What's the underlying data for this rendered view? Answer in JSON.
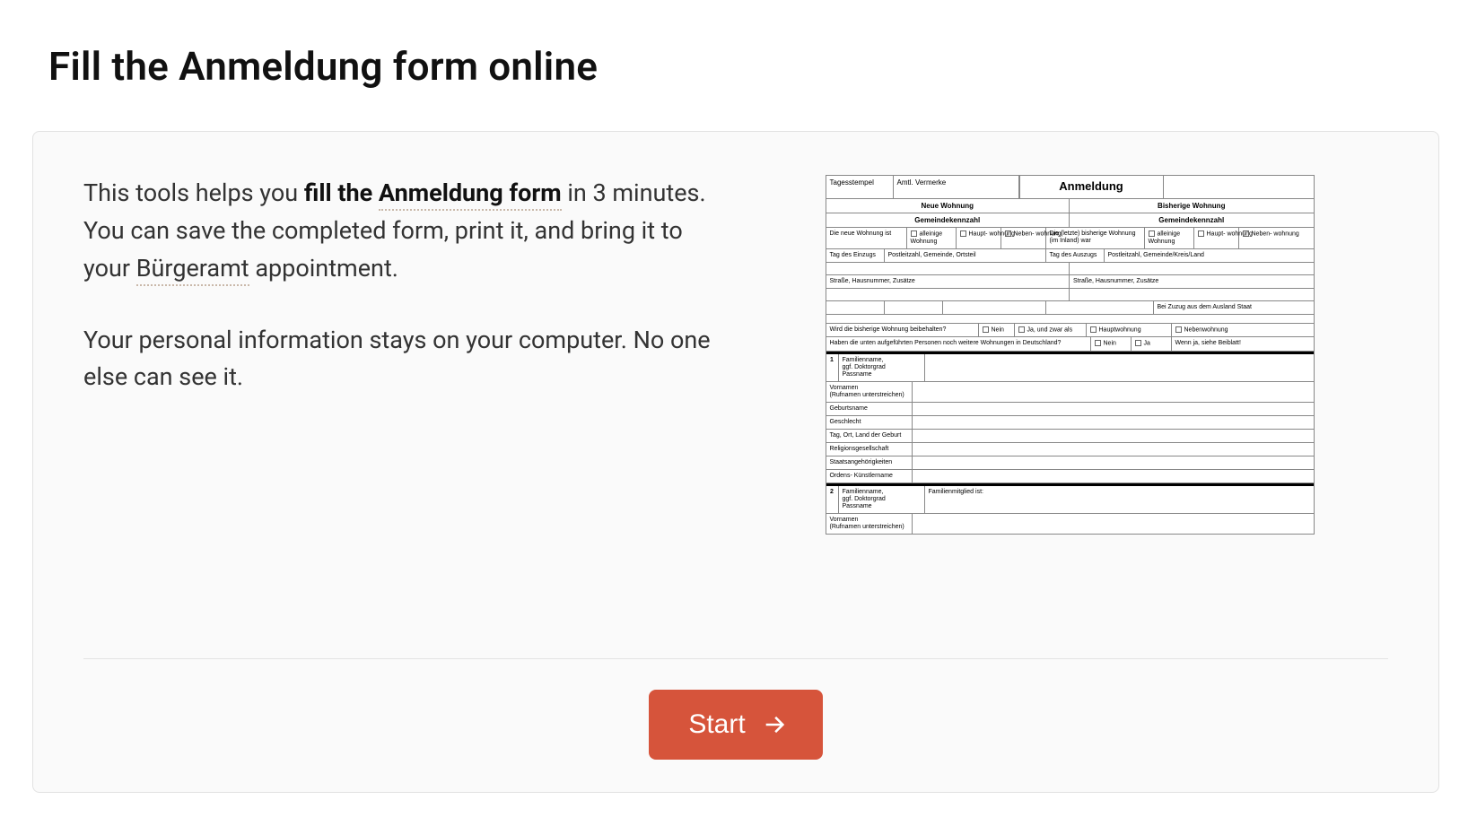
{
  "title": "Fill the Anmeldung form online",
  "intro": {
    "p1_a": "This tools helps you ",
    "p1_bold": "fill the ",
    "p1_link": "Anmeldung form",
    "p1_b": " in 3 minutes. You can save the completed form, print it, and bring it to your ",
    "p1_link2": "Bürgeramt",
    "p1_c": " appointment.",
    "p2": "Your personal information stays on your computer. No one else can see it."
  },
  "start_button": "Start",
  "form": {
    "tagesstempel": "Tagesstempel",
    "amtl": "Amtl. Vermerke",
    "anmeldung": "Anmeldung",
    "neue": "Neue Wohnung",
    "bisherige": "Bisherige Wohnung",
    "gkz": "Gemeindekennzahl",
    "neue_ist": "Die neue Wohnung ist",
    "bisherige_ist": "Die (letzte) bisherige Wohnung (im Inland) war",
    "alleinige": "alleinige Wohnung",
    "haupt": "Haupt-\nwohnung",
    "neben": "Neben-\nwohnung",
    "tag_einzug": "Tag des Einzugs",
    "tag_auszug": "Tag des Auszugs",
    "plz_ort": "Postleitzahl, Gemeinde, Ortsteil",
    "plz_land": "Postleitzahl, Gemeinde/Kreis/Land",
    "strasse": "Straße, Hausnummer, Zusätze",
    "zusug": "Bei Zuzug aus dem Ausland Staat",
    "beibehalten": "Wird die bisherige Wohnung beibehalten?",
    "nein": "Nein",
    "ja_zwar": "Ja, und zwar als",
    "hauptwohnung": "Hauptwohnung",
    "nebenwohnung": "Nebenwohnung",
    "weitere": "Haben die unten aufgeführten Personen noch weitere Wohnungen in Deutschland?",
    "ja": "Ja",
    "wennja": "Wenn ja, siehe Beiblatt!",
    "fam": "Familienname,\nggf. Doktorgrad\nPassname",
    "vorn": "Vornamen",
    "unter": "(Rufnamen unterstreichen)",
    "geburtsname": "Geburtsname",
    "geschlecht": "Geschlecht",
    "tag_ort": "Tag, Ort, Land der Geburt",
    "religion": "Religionsgesellschaft",
    "staats": "Staatsangehörigkeiten",
    "ordens": "Ordens-  Künstlername",
    "fam_mitglied": "Familienmitglied ist:"
  }
}
